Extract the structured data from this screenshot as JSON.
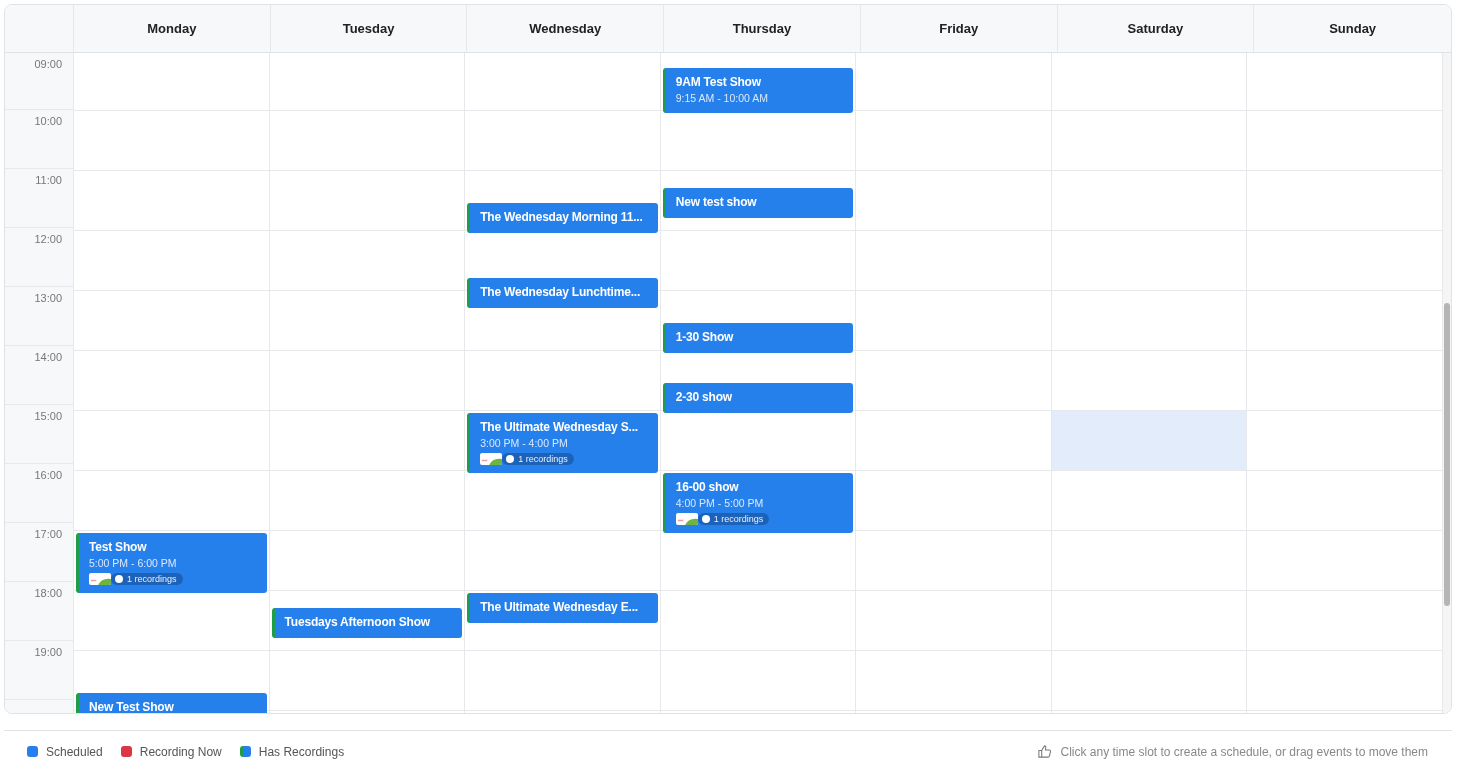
{
  "days": [
    {
      "label": "Monday",
      "events": [
        {
          "title": "Test Show",
          "time": "5:00 PM - 6:00 PM",
          "recordings": "1 recordings",
          "has_recordings": true
        },
        {
          "title": "New Test Show",
          "has_recordings": true
        }
      ]
    },
    {
      "label": "Tuesday",
      "events": [
        {
          "title": "Tuesdays Afternoon Show",
          "has_recordings": true
        }
      ]
    },
    {
      "label": "Wednesday",
      "events": [
        {
          "title": "The Wednesday Morning 11...",
          "has_recordings": true
        },
        {
          "title": "The Wednesday Lunchtime...",
          "has_recordings": true
        },
        {
          "title": "The Ultimate Wednesday S...",
          "time": "3:00 PM - 4:00 PM",
          "recordings": "1 recordings",
          "has_recordings": true
        },
        {
          "title": "The Ultimate Wednesday E...",
          "has_recordings": true
        }
      ]
    },
    {
      "label": "Thursday",
      "events": [
        {
          "title": "9AM Test Show",
          "time": "9:15 AM - 10:00 AM",
          "has_recordings": true
        },
        {
          "title": "New test show",
          "has_recordings": true
        },
        {
          "title": "1-30 Show",
          "has_recordings": true
        },
        {
          "title": "2-30 show",
          "has_recordings": true
        },
        {
          "title": "16-00 show",
          "time": "4:00 PM - 5:00 PM",
          "recordings": "1 recordings",
          "has_recordings": true
        }
      ]
    },
    {
      "label": "Friday"
    },
    {
      "label": "Saturday"
    },
    {
      "label": "Sunday"
    }
  ],
  "hours": [
    {
      "label": "09:00",
      "hovered": false
    },
    {
      "label": "10:00",
      "hovered": false
    },
    {
      "label": "11:00",
      "hovered": false
    },
    {
      "label": "12:00",
      "hovered": false
    },
    {
      "label": "13:00",
      "hovered": false
    },
    {
      "label": "14:00",
      "hovered": false
    },
    {
      "label": "15:00",
      "hovered": true
    },
    {
      "label": "16:00",
      "hovered": false
    },
    {
      "label": "17:00",
      "hovered": false
    },
    {
      "label": "18:00",
      "hovered": false
    },
    {
      "label": "19:00",
      "hovered": false
    }
  ],
  "legend": [
    {
      "label": "Scheduled",
      "kind": "solid",
      "color": "#2680eb"
    },
    {
      "label": "Recording Now",
      "kind": "solid",
      "color": "#dc3545"
    },
    {
      "label": "Has Recordings",
      "kind": "split",
      "color": "#2680eb"
    }
  ],
  "hint": "Click any time slot to create a schedule, or drag events to move them"
}
